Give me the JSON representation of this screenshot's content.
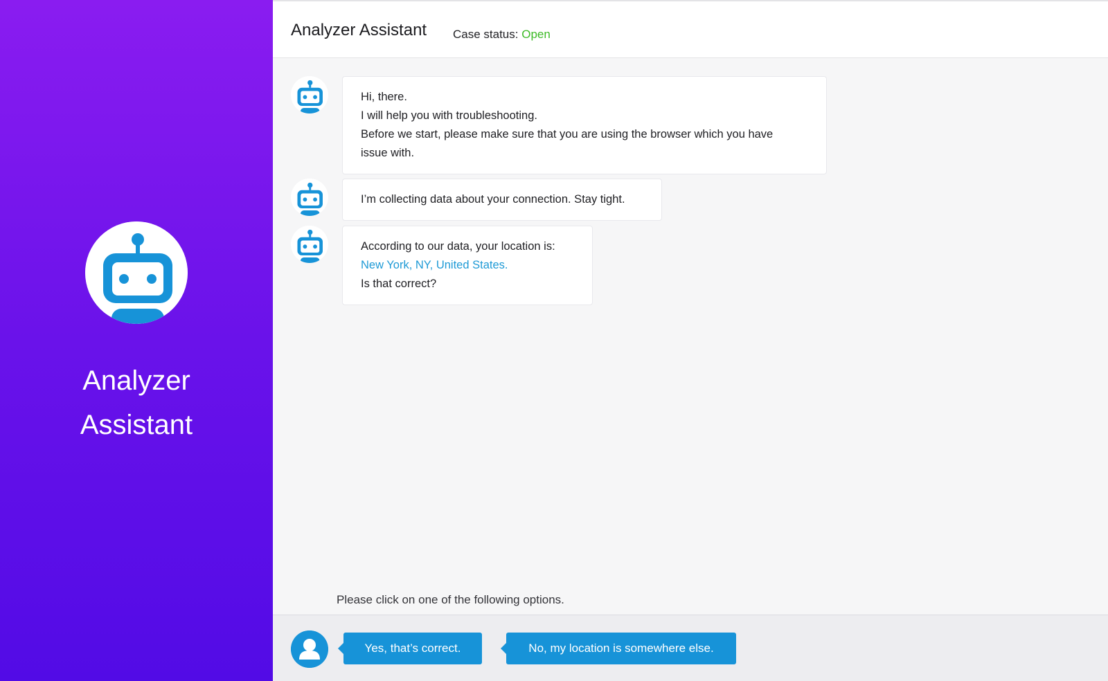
{
  "sidebar": {
    "avatar_icon": "robot-icon",
    "title_line1": "Analyzer",
    "title_line2": "Assistant",
    "gradient_top": "#8a1cf0",
    "gradient_bottom": "#520be6"
  },
  "header": {
    "title": "Analyzer Assistant",
    "case_status_label": "Case status:",
    "case_status_value": "Open",
    "status_color": "#3dbb27"
  },
  "messages": [
    {
      "avatar_icon": "robot-icon",
      "lines": [
        "Hi, there.",
        "I will help you with troubleshooting.",
        "Before we start, please make sure that you are using the browser which you have",
        "issue with."
      ]
    },
    {
      "avatar_icon": "robot-icon",
      "lines": [
        "I’m collecting data about your connection. Stay tight."
      ]
    },
    {
      "avatar_icon": "robot-icon",
      "lines": [
        "According to our data, your location is:",
        "New York, NY, United States.",
        "Is that correct?"
      ]
    }
  ],
  "prompt": "Please click on one of the following options.",
  "options": {
    "user_icon": "user-icon",
    "yes_label": "Yes, that’s correct.",
    "no_label": "No, my location is somewhere else."
  },
  "colors": {
    "accent": "#1793d8",
    "link": "#1e9ad6"
  }
}
